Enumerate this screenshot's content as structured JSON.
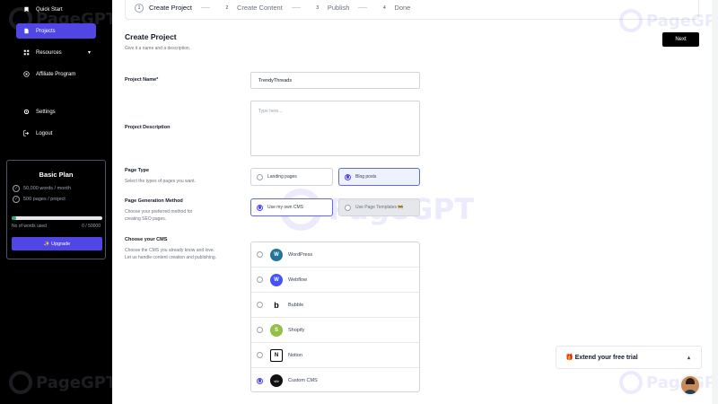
{
  "sidebar": {
    "items": [
      {
        "label": "Quick Start",
        "icon": "bookmark-icon"
      },
      {
        "label": "Projects",
        "icon": "document-icon",
        "active": true
      },
      {
        "label": "Resources",
        "icon": "grid-icon",
        "chevron": "▾"
      },
      {
        "label": "Affiliate Program",
        "icon": "target-icon"
      },
      {
        "label": "Settings",
        "icon": "gear-icon"
      },
      {
        "label": "Logout",
        "icon": "logout-icon"
      }
    ],
    "plan": {
      "title": "Basic Plan",
      "features": [
        "50,000 words / month",
        "500 pages / project"
      ],
      "usage_label": "No of words used",
      "usage_value": "0 / 50000",
      "usage_fraction": 0.05,
      "upgrade_label": "✨ Upgrade"
    },
    "watermark": "PageGPT"
  },
  "stepper": {
    "steps": [
      {
        "num": "1",
        "label": "Create Project",
        "active": true
      },
      {
        "num": "2",
        "label": "Create Content"
      },
      {
        "num": "3",
        "label": "Publish"
      },
      {
        "num": "4",
        "label": "Done"
      }
    ]
  },
  "main": {
    "title": "Create Project",
    "subtitle": "Give it a name and a description.",
    "next_label": "Next",
    "project_name": {
      "label": "Project Name*",
      "value": "TrendyThreads"
    },
    "project_description": {
      "label": "Project Description",
      "placeholder": "Type here..."
    },
    "page_type": {
      "label": "Page Type",
      "help": "Select the types of pages you want.",
      "options": [
        {
          "label": "Landing pages",
          "selected": false
        },
        {
          "label": "Blog posts",
          "selected": true
        }
      ]
    },
    "generation_method": {
      "label": "Page Generation Method",
      "help": "Choose your preferred method for creating SEO pages.",
      "options": [
        {
          "label": "Use my own CMS",
          "selected": true
        },
        {
          "label": "Use Page Templates 🚧",
          "selected": false,
          "disabled": true
        }
      ]
    },
    "cms": {
      "label": "Choose your CMS",
      "help": "Choose the CMS you already know and love. Let us handle content creation and publishing.",
      "options": [
        {
          "label": "WordPress",
          "logo": "W",
          "color": "#21759b",
          "selected": false
        },
        {
          "label": "Webflow",
          "logo": "W",
          "color": "#4353ff",
          "selected": false
        },
        {
          "label": "Bubble",
          "logo": "b",
          "color": "#ffffff",
          "selected": false
        },
        {
          "label": "Shopify",
          "logo": "S",
          "color": "#95bf47",
          "selected": false
        },
        {
          "label": "Notion",
          "logo": "N",
          "color": "#ffffff",
          "selected": false
        },
        {
          "label": "Custom CMS",
          "logo": "</>",
          "color": "#111111",
          "selected": true
        }
      ]
    }
  },
  "extend_trial": {
    "label": "🎁 Extend your free trial",
    "chevron": "▴"
  }
}
